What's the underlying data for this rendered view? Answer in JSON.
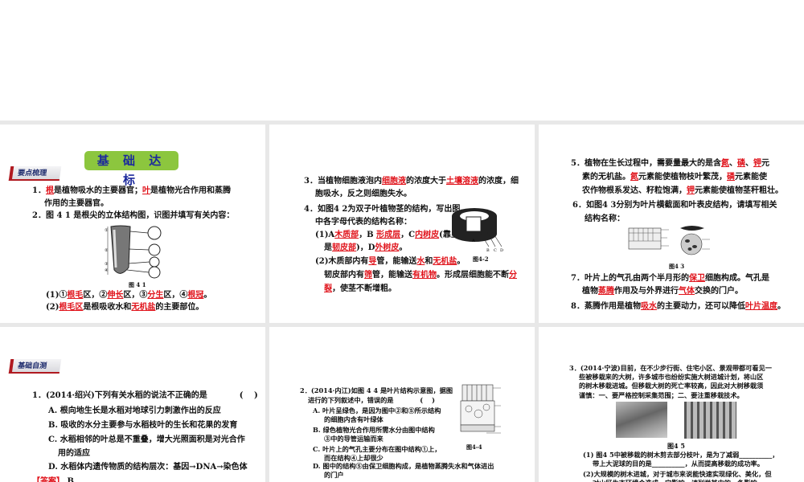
{
  "p1": {
    "badge": "基 础 达 标",
    "tag": "要点梳理",
    "lines": [
      [
        {
          "t": "1．"
        },
        {
          "a": "根"
        },
        {
          "t": "是植物吸水的主要器官；"
        },
        {
          "a": "叶"
        },
        {
          "t": "是植物光合作用和蒸腾"
        }
      ],
      [
        {
          "t": "作用的主要器官。"
        }
      ],
      [
        {
          "t": "2．图 4 1 是根尖的立体结构图，识图并填写有关内容："
        }
      ],
      [
        {
          "t": "(1)①"
        },
        {
          "a": "根毛"
        },
        {
          "t": "区，②"
        },
        {
          "a": "伸长"
        },
        {
          "t": "区，③"
        },
        {
          "a": "分生"
        },
        {
          "t": "区，④"
        },
        {
          "a": "根冠"
        },
        {
          "t": "。"
        }
      ],
      [
        {
          "t": "(2)"
        },
        {
          "a": "根毛区"
        },
        {
          "t": "是根吸收水和"
        },
        {
          "a": "无机盐"
        },
        {
          "t": "的主要部位。"
        }
      ]
    ],
    "caption": "图 4 1",
    "fig_labels": [
      "①",
      "②",
      "③",
      "④"
    ]
  },
  "p2": {
    "lines": [
      [
        {
          "t": "3．当植物细胞液泡内"
        },
        {
          "a": "细胞液"
        },
        {
          "t": "的浓度大于"
        },
        {
          "a": "土壤溶液"
        },
        {
          "t": "的浓度，细"
        }
      ],
      [
        {
          "t": "胞吸水，反之则细胞失水。"
        }
      ],
      [
        {
          "t": "4．如图4 2为双子叶植物茎的结构，写出图"
        }
      ],
      [
        {
          "t": "中各字母代表的结构名称："
        }
      ],
      [
        {
          "t": "(1)A"
        },
        {
          "a": "木质部"
        },
        {
          "t": "，B "
        },
        {
          "a": "形成层"
        },
        {
          "t": "，C"
        },
        {
          "a": "内树皮"
        },
        {
          "t": "(靠里"
        }
      ],
      [
        {
          "t": "是"
        },
        {
          "a": "韧皮部"
        },
        {
          "t": ")，D"
        },
        {
          "a": "外树皮"
        },
        {
          "t": "。"
        }
      ],
      [
        {
          "t": "(2)木质部内有"
        },
        {
          "a": "导"
        },
        {
          "t": "管，能输送"
        },
        {
          "a": "水"
        },
        {
          "t": "和"
        },
        {
          "a": "无机盐"
        },
        {
          "t": "。"
        }
      ],
      [
        {
          "t": "韧皮部内有"
        },
        {
          "a": "筛"
        },
        {
          "t": "管，能输送"
        },
        {
          "a": "有机物"
        },
        {
          "t": "。形成层细胞能不断"
        },
        {
          "a": "分"
        }
      ],
      [
        {
          "a": "裂"
        },
        {
          "t": "，使茎不断增粗。"
        }
      ]
    ],
    "caption": "图4-2",
    "fig_labels": [
      "A",
      "B",
      "C",
      "D"
    ]
  },
  "p3": {
    "lines": [
      [
        {
          "t": "5．植物在生长过程中，需要量最大的是含"
        },
        {
          "a": "氮"
        },
        {
          "t": "、"
        },
        {
          "a": "磷"
        },
        {
          "t": "、"
        },
        {
          "a": "钾"
        },
        {
          "t": "元"
        }
      ],
      [
        {
          "t": "素的无机盐。"
        },
        {
          "a": "氮"
        },
        {
          "t": "元素能使植物枝叶繁茂，"
        },
        {
          "a": "磷"
        },
        {
          "t": "元素能使"
        }
      ],
      [
        {
          "t": "农作物根系发达、籽粒饱满，"
        },
        {
          "a": "钾"
        },
        {
          "t": "元素能使植物茎秆粗壮。"
        }
      ],
      [
        {
          "t": "6．如图4 3分别为叶片横截面和叶表皮结构，请填写相关"
        }
      ],
      [
        {
          "t": "结构名称："
        }
      ],
      [
        {
          "t": "7．叶片上的气孔由两个半月形的"
        },
        {
          "a": "保卫"
        },
        {
          "t": "细胞构成。气孔是"
        }
      ],
      [
        {
          "t": "植物"
        },
        {
          "a": "蒸腾"
        },
        {
          "t": "作用及与外界进行"
        },
        {
          "a": "气体"
        },
        {
          "t": "交换的门户。"
        }
      ],
      [
        {
          "t": "8．蒸腾作用是植物"
        },
        {
          "a": "吸水"
        },
        {
          "t": "的主要动力，还可以降低"
        },
        {
          "a": "叶片温度"
        },
        {
          "t": "。"
        }
      ]
    ],
    "caption": "图4 3"
  },
  "p4": {
    "tag": "基础自测",
    "lines": [
      [
        {
          "t": "1．(2014·绍兴)下列有关水稻的说法不正确的是　　　　(　 )"
        }
      ],
      [
        {
          "t": "A. 根向地生长是水稻对地球引力刺激作出的反应"
        }
      ],
      [
        {
          "t": "B. 吸收的水分主要参与水稻枝叶的生长和花果的发育"
        }
      ],
      [
        {
          "t": "C. 水稻相邻的叶总是不重叠，增大光照面积是对光合作"
        }
      ],
      [
        {
          "t": "用的适应"
        }
      ],
      [
        {
          "t": "D. 水稻体内遗传物质的结构层次：基因→DNA→染色体"
        }
      ],
      [
        {
          "a": "【答案】"
        },
        {
          "t": " B"
        }
      ]
    ]
  },
  "p5": {
    "lines": [
      [
        {
          "t": "2．(2014·内江)如图 4 4 是叶片结构示意图，据图"
        }
      ],
      [
        {
          "t": "进行的下列叙述中，错误的是　　　　(　 )"
        }
      ],
      [
        {
          "t": "A.  叶片呈绿色，是因为图中②和⑤所示结构"
        }
      ],
      [
        {
          "t": "的细胞内含有叶绿体"
        }
      ],
      [
        {
          "t": "B.  绿色植物光合作用所需水分由图中结构"
        }
      ],
      [
        {
          "t": "③中的导管运输而来"
        }
      ],
      [
        {
          "t": "C.  叶片上的气孔主要分布在图中结构①上，"
        }
      ],
      [
        {
          "t": "而在结构④上却很少"
        }
      ],
      [
        {
          "t": "D.  图中的结构⑤由保卫细胞构成，是植物蒸腾失水和气体进出"
        }
      ],
      [
        {
          "t": "的门户"
        }
      ]
    ],
    "caption": "图4-4"
  },
  "p6": {
    "lines": [
      [
        {
          "t": "3．(2014·宁波)目前，在不少步行街、住宅小区、景观带都可看见一"
        }
      ],
      [
        {
          "t": "些被移栽来的大树，许多城市也纷纷实施大树进城计划，将山区"
        }
      ],
      [
        {
          "t": "的树木移栽进城。但移栽大树的死亡率较高，因此对大树移栽须"
        }
      ],
      [
        {
          "t": "谨慎：一、要严格控制采集范围；二、要注重移栽技术。"
        }
      ],
      [
        {
          "t": "(1) 图4 5中被移栽的树木剪去部分枝叶，是为了减弱__________，"
        }
      ],
      [
        {
          "t": "带上大泥球的目的是__________，从而提高移栽的成功率。"
        }
      ],
      [
        {
          "t": "(2)大规模的树木进城，对于城市来说能快速实现绿化、美化，但"
        }
      ],
      [
        {
          "t": "对山区生态环境会造成一定影响，请列举其中的一条影响"
        }
      ]
    ],
    "caption": "图4 5"
  }
}
